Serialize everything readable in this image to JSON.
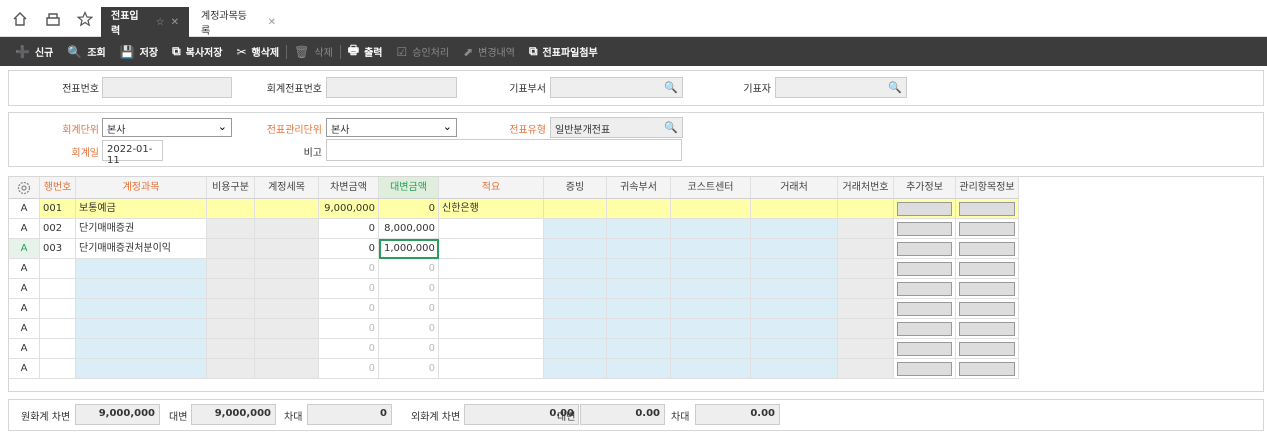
{
  "tabs": [
    {
      "label": "전표입력",
      "active": true
    },
    {
      "label": "계정과목등록",
      "active": false
    }
  ],
  "toolbar": [
    {
      "icon": "➕",
      "label": "신규",
      "disabled": false,
      "name": "new-button",
      "iconname": "new-doc-icon"
    },
    {
      "icon": "🔍",
      "label": "조회",
      "disabled": false,
      "name": "search-button",
      "iconname": "search-icon"
    },
    {
      "icon": "💾",
      "label": "저장",
      "disabled": false,
      "name": "save-button",
      "iconname": "save-icon"
    },
    {
      "icon": "⧉",
      "label": "복사저장",
      "disabled": false,
      "name": "copy-save-button",
      "iconname": "copy-icon"
    },
    {
      "icon": "✂",
      "label": "행삭제",
      "disabled": false,
      "name": "delete-row-button",
      "iconname": "scissors-icon"
    },
    {
      "icon": "🗑",
      "label": "삭제",
      "disabled": true,
      "name": "delete-button",
      "iconname": "trash-icon"
    },
    {
      "icon": "🖶",
      "label": "출력",
      "disabled": false,
      "name": "print-button",
      "iconname": "printer-icon"
    },
    {
      "icon": "☑",
      "label": "승인처리",
      "disabled": true,
      "name": "approve-button",
      "iconname": "check-icon"
    },
    {
      "icon": "⬈",
      "label": "변경내역",
      "disabled": true,
      "name": "history-button",
      "iconname": "external-icon"
    },
    {
      "icon": "⧉",
      "label": "전표파일첨부",
      "disabled": false,
      "name": "attach-button",
      "iconname": "attach-icon"
    }
  ],
  "header1": {
    "voucher_no_label": "전표번호",
    "voucher_no": "",
    "acct_voucher_no_label": "회계전표번호",
    "acct_voucher_no": "",
    "dept_label": "기표부서",
    "dept": "",
    "writer_label": "기표자",
    "writer": ""
  },
  "header2": {
    "unit_label": "회계단위",
    "unit": "본사",
    "mgmt_unit_label": "전표관리단위",
    "mgmt_unit": "본사",
    "type_label": "전표유형",
    "type": "일반분개전표",
    "date_label": "회계일",
    "date": "2022-01-11",
    "memo_label": "비고",
    "memo": ""
  },
  "columns": [
    "행번호",
    "계정과목",
    "비용구분",
    "계정세목",
    "차변금액",
    "대변금액",
    "적요",
    "증빙",
    "귀속부서",
    "코스트센터",
    "거래처",
    "거래처번호",
    "추가정보",
    "관리항목정보"
  ],
  "rows": [
    {
      "status": "A",
      "no": "001",
      "account": "보통예금",
      "debit": "9,000,000",
      "credit": "0",
      "memo": "신한은행"
    },
    {
      "status": "A",
      "no": "002",
      "account": "단기매매증권",
      "debit": "0",
      "credit": "8,000,000",
      "memo": ""
    },
    {
      "status": "A",
      "no": "003",
      "account": "단기매매증권처분이익",
      "debit": "0",
      "credit": "1,000,000",
      "memo": ""
    },
    {
      "status": "A",
      "no": "",
      "account": "",
      "debit": "0",
      "credit": "0",
      "memo": ""
    },
    {
      "status": "A",
      "no": "",
      "account": "",
      "debit": "0",
      "credit": "0",
      "memo": ""
    },
    {
      "status": "A",
      "no": "",
      "account": "",
      "debit": "0",
      "credit": "0",
      "memo": ""
    },
    {
      "status": "A",
      "no": "",
      "account": "",
      "debit": "0",
      "credit": "0",
      "memo": ""
    },
    {
      "status": "A",
      "no": "",
      "account": "",
      "debit": "0",
      "credit": "0",
      "memo": ""
    },
    {
      "status": "A",
      "no": "",
      "account": "",
      "debit": "0",
      "credit": "0",
      "memo": ""
    }
  ],
  "footer": {
    "krw_debit_label": "원화계 차변",
    "krw_debit": "9,000,000",
    "krw_credit_label": "대변",
    "krw_credit": "9,000,000",
    "krw_diff_label": "차대",
    "krw_diff": "0",
    "fx_debit_label": "외화계 차변",
    "fx_debit": "0.00",
    "fx_credit_label": "대변",
    "fx_credit": "0.00",
    "fx_diff_label": "차대",
    "fx_diff": "0.00"
  },
  "colors": {
    "toolbar_bg": "#3c3c3c",
    "required_label": "#e5743d",
    "selected_row": "#ffffa8",
    "editable_cell": "#dbeef8"
  }
}
